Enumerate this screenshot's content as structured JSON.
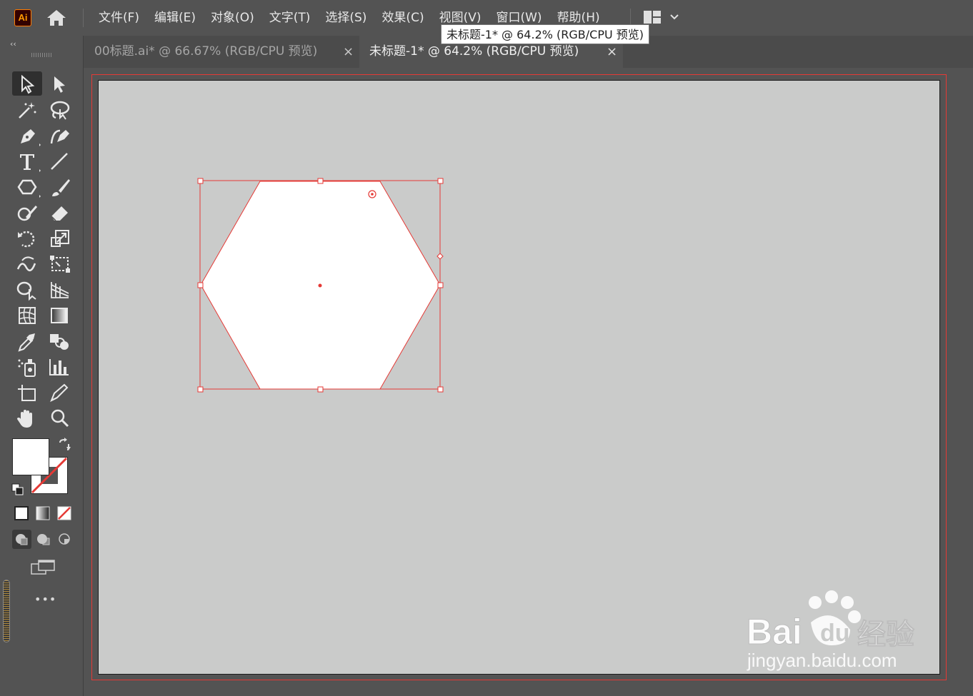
{
  "app": {
    "logo_text": "Ai"
  },
  "menu": {
    "items": [
      "文件(F)",
      "编辑(E)",
      "对象(O)",
      "文字(T)",
      "选择(S)",
      "效果(C)",
      "视图(V)",
      "窗口(W)",
      "帮助(H)"
    ]
  },
  "tooltip": {
    "text": "未标题-1* @ 64.2% (RGB/CPU 预览)"
  },
  "tabs": [
    {
      "label": "00标题.ai* @ 66.67% (RGB/CPU 预览)",
      "close": "×",
      "active": false
    },
    {
      "label": "未标题-1* @ 64.2% (RGB/CPU 预览)",
      "close": "×",
      "active": true
    }
  ],
  "toolbar": {
    "collapse_label": "‹‹",
    "more_label": "•••"
  },
  "colors": {
    "selection": "#e53935",
    "artboard": "#cacbca",
    "chrome": "#535353",
    "accent_logo": "#ff9a00"
  },
  "watermark": {
    "brand": "Bai du 经验",
    "url": "jingyan.baidu.com"
  }
}
